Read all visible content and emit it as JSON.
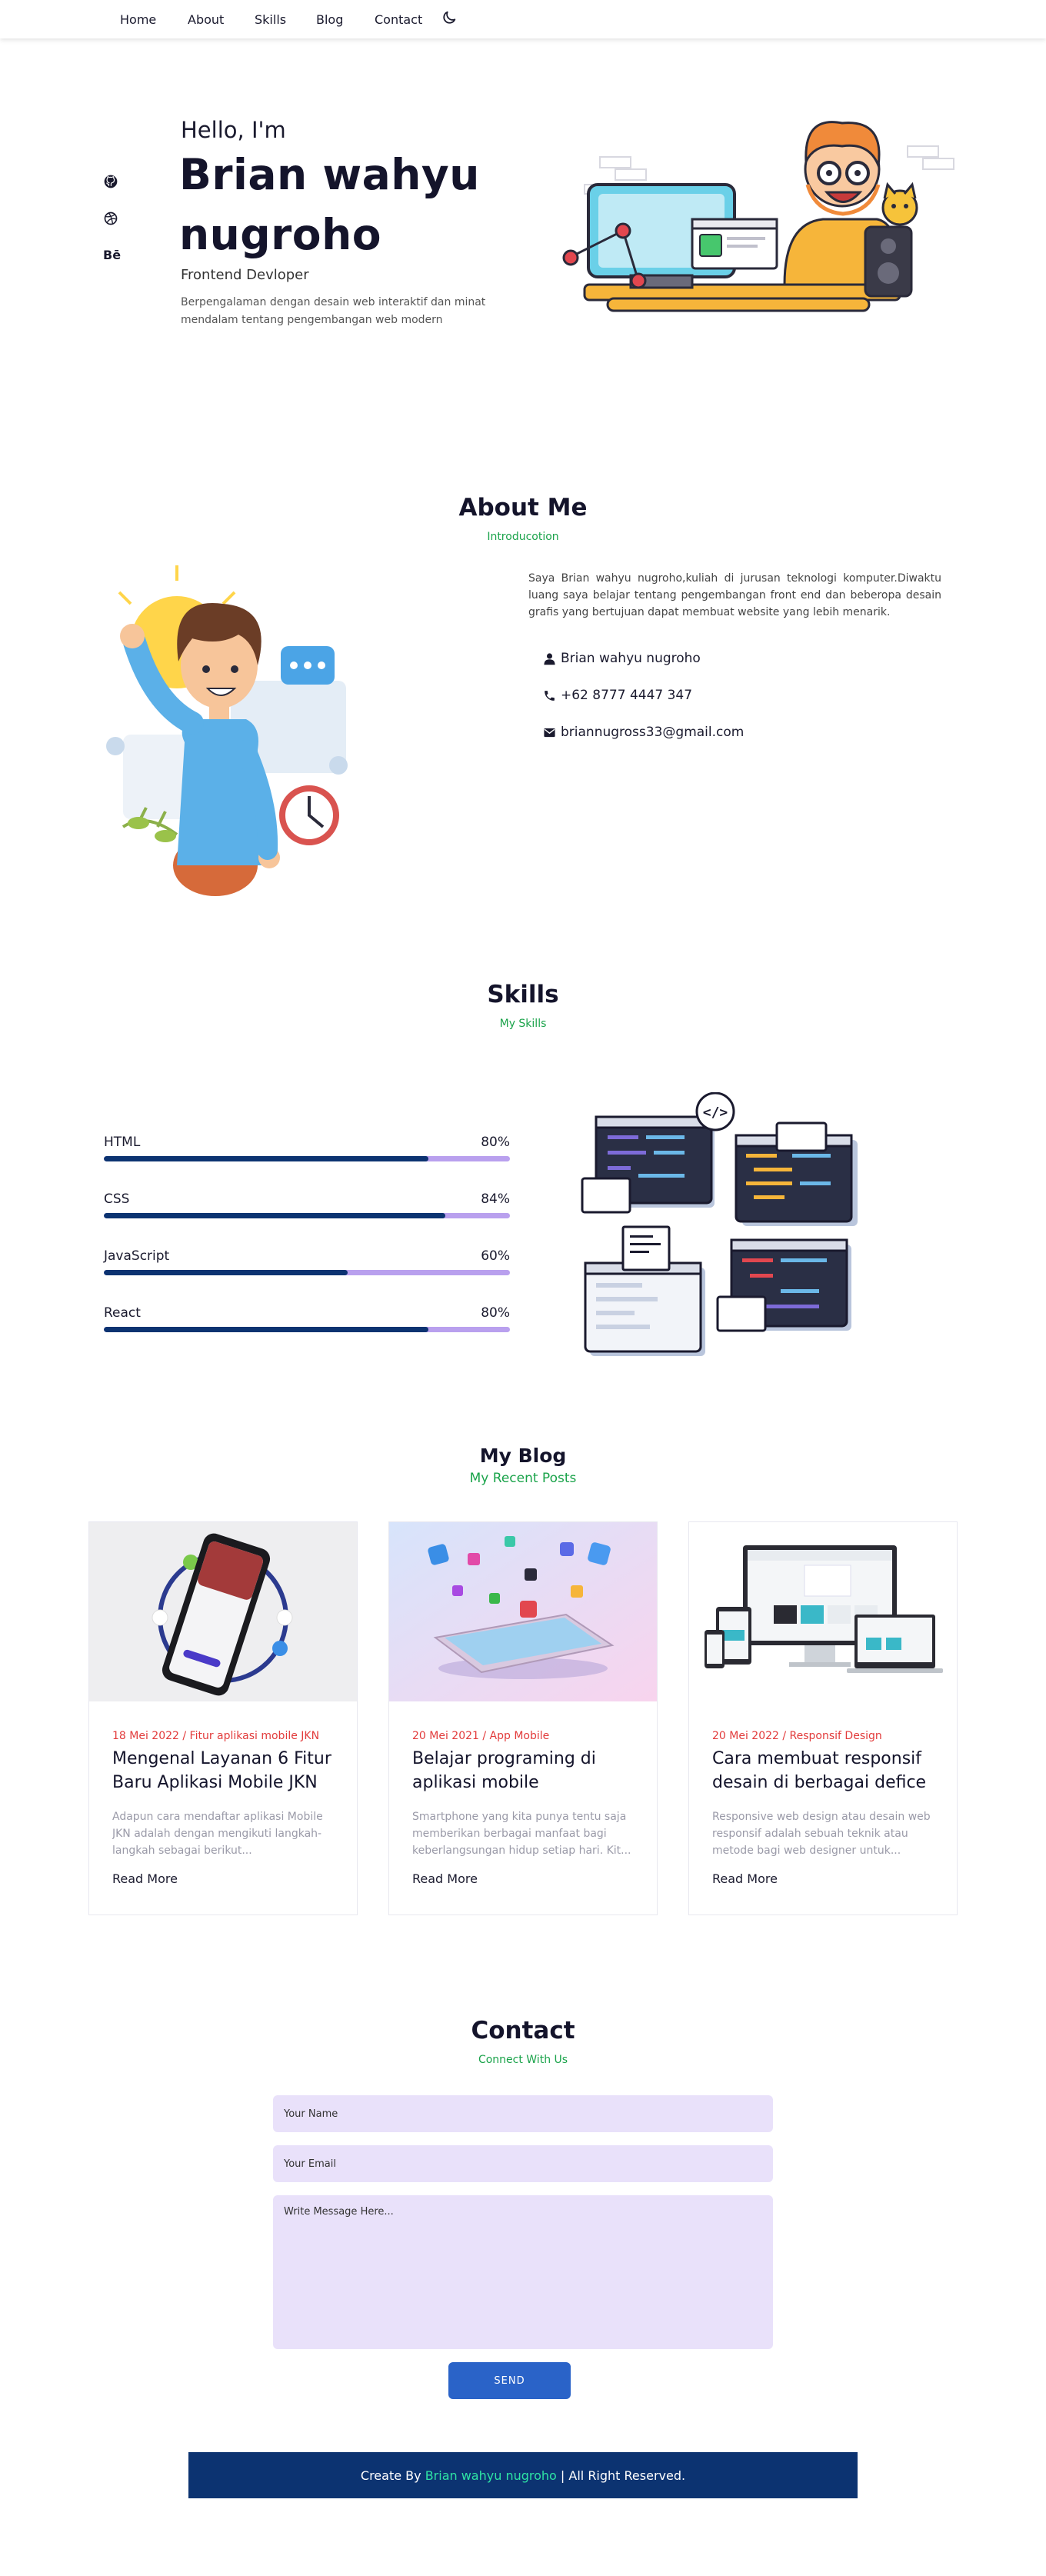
{
  "nav": {
    "items": [
      "Home",
      "About",
      "Skills",
      "Blog",
      "Contact"
    ],
    "theme_toggle_icon": "moon-icon"
  },
  "hero": {
    "greeting": "Hello, I'm",
    "name": "Brian wahyu nugroho",
    "role": "Frontend Devloper",
    "description": "Berpengalaman dengan desain web interaktif dan minat mendalam tentang pengembangan web modern",
    "social_icons": [
      "github-icon",
      "dribbble-icon",
      "behance-icon"
    ],
    "social_behance_text": "Bē"
  },
  "about": {
    "title": "About Me",
    "subtitle": "Introducotion",
    "description": "Saya Brian wahyu nugroho,kuliah di jurusan teknologi komputer.Diwaktu luang saya belajar tentang pengembangan front end dan beberopa desain grafis yang bertujuan dapat membuat website yang lebih menarik.",
    "name": "Brian wahyu nugroho",
    "phone": "+62 8777 4447 347",
    "email": "briannugross33@gmail.com"
  },
  "skills": {
    "title": "Skills",
    "subtitle": "My Skills",
    "items": [
      {
        "label": "HTML",
        "percent_text": "80%",
        "value": 80
      },
      {
        "label": "CSS",
        "percent_text": "84%",
        "value": 84
      },
      {
        "label": "JavaScript",
        "percent_text": "60%",
        "value": 60
      },
      {
        "label": "React",
        "percent_text": "80%",
        "value": 80
      }
    ]
  },
  "blog": {
    "title": "My Blog",
    "subtitle": "My Recent Posts",
    "posts": [
      {
        "meta": "18 Mei 2022 / Fitur aplikasi mobile JKN",
        "title": "Mengenal Layanan 6 Fitur Baru Aplikasi Mobile JKN",
        "excerpt": "Adapun cara mendaftar aplikasi Mobile JKN adalah dengan mengikuti langkah-langkah sebagai berikut...",
        "read_more": "Read More"
      },
      {
        "meta": "20 Mei 2021 / App Mobile",
        "title": "Belajar programing di aplikasi mobile",
        "excerpt": "Smartphone yang kita punya tentu saja memberikan berbagai manfaat bagi keberlangsungan hidup setiap hari. Kit...",
        "read_more": "Read More"
      },
      {
        "meta": "20 Mei 2022 / Responsif Design",
        "title": "Cara membuat responsif desain di berbagai defice",
        "excerpt": "Responsive web design atau desain web responsif adalah sebuah teknik atau metode bagi web designer untuk...",
        "read_more": "Read More"
      }
    ]
  },
  "contact": {
    "title": "Contact",
    "subtitle": "Connect With Us",
    "name_placeholder": "Your Name",
    "email_placeholder": "Your Email",
    "message_placeholder": "Write Message Here...",
    "send_label": "SEND"
  },
  "footer": {
    "prefix": "Create By ",
    "author": "Brian wahyu nugroho",
    "suffix": " | All Right Reserved."
  },
  "colors": {
    "accent_green": "#1aa34a",
    "navy": "#0c3371",
    "lavender": "#b9a0ee",
    "field_bg": "#e9e1fa",
    "button_blue": "#2a63c8",
    "date_red": "#e23b3b"
  }
}
